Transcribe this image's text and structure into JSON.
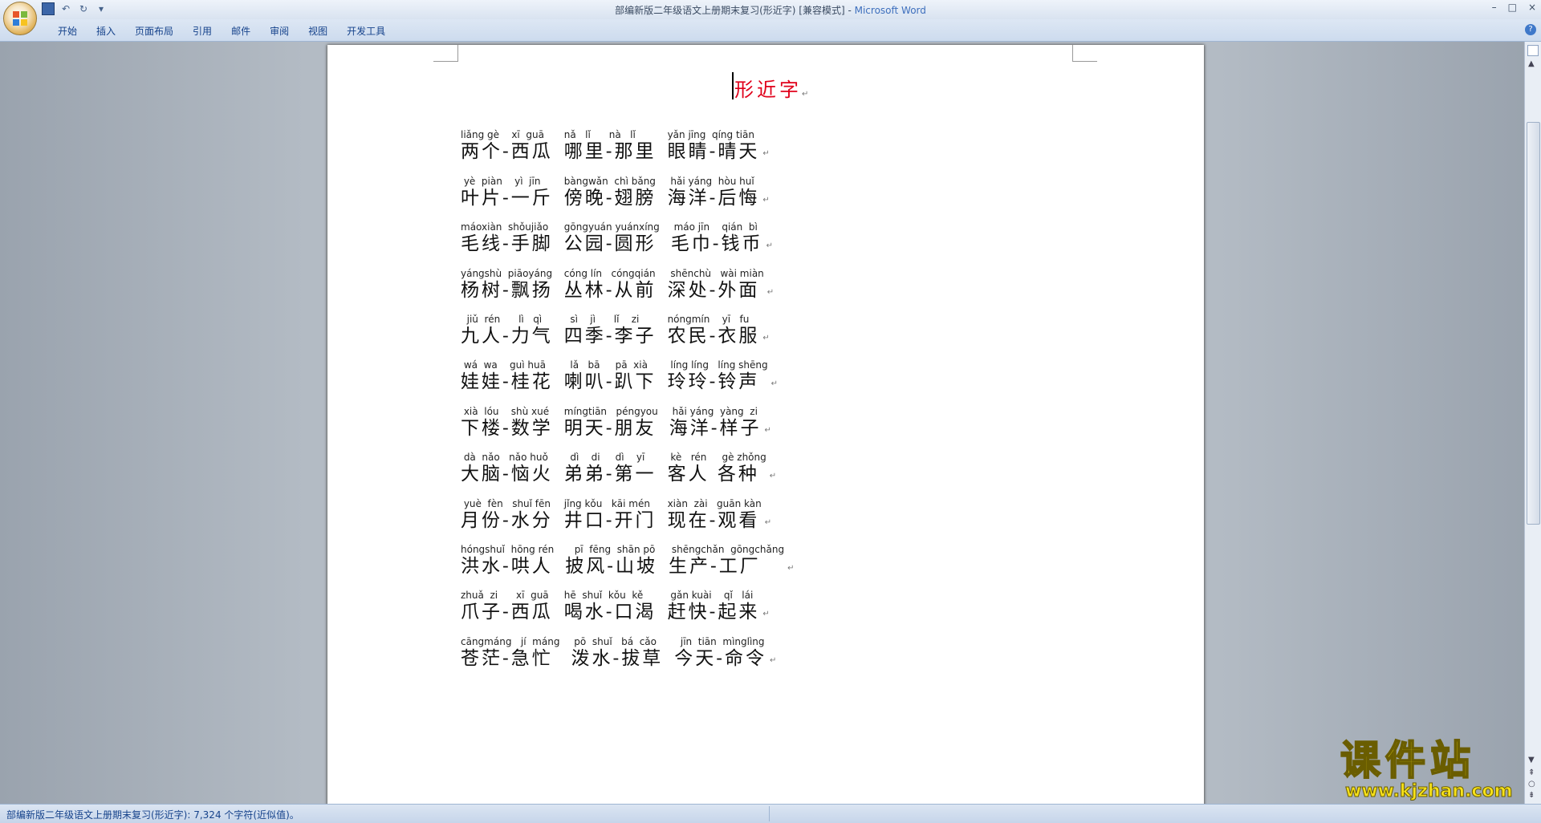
{
  "window": {
    "title": "部编新版二年级语文上册期末复习(形近字) [兼容模式] - ",
    "app_name": "Microsoft Word",
    "controls": [
      "–",
      "□",
      "×"
    ]
  },
  "qat": {
    "undo": "↶",
    "redo": "↻",
    "customize": "▾"
  },
  "ribbon": {
    "tabs": [
      "开始",
      "插入",
      "页面布局",
      "引用",
      "邮件",
      "审阅",
      "视图",
      "开发工具"
    ],
    "help": "?"
  },
  "document": {
    "title": "形近字",
    "para_mark": "↵",
    "rows": [
      {
        "groups": [
          {
            "py": "liǎng gè    xī  guā",
            "hz": "两个-西瓜"
          },
          {
            "py": "nǎ   lǐ      nà   lǐ",
            "hz": "哪里-那里"
          },
          {
            "py": "yǎn jīng  qíng tiān",
            "hz": "眼睛-晴天"
          }
        ]
      },
      {
        "groups": [
          {
            "py": " yè  piàn    yì  jīn",
            "hz": "叶片-一斤"
          },
          {
            "py": "bàngwǎn  chì bǎng",
            "hz": "傍晚-翅膀"
          },
          {
            "py": " hǎi yáng  hòu huǐ",
            "hz": "海洋-后悔"
          }
        ]
      },
      {
        "groups": [
          {
            "py": "máoxiàn  shǒujiǎo",
            "hz": "毛线-手脚"
          },
          {
            "py": "gōngyuán yuánxíng",
            "hz": "公园-圆形"
          },
          {
            "py": " máo jīn    qián  bì",
            "hz": "毛巾-钱币"
          }
        ]
      },
      {
        "groups": [
          {
            "py": "yángshù  piāoyáng",
            "hz": "杨树-飘扬"
          },
          {
            "py": "cóng lín   cóngqián",
            "hz": "丛林-从前"
          },
          {
            "py": " shēnchù   wài miàn",
            "hz": "深处-外面"
          }
        ]
      },
      {
        "groups": [
          {
            "py": "  jiǔ  rén      lì   qì",
            "hz": "九人-力气"
          },
          {
            "py": "  sì    jì      lǐ    zi",
            "hz": "四季-李子"
          },
          {
            "py": "nóngmín    yī   fu",
            "hz": "农民-衣服"
          }
        ]
      },
      {
        "groups": [
          {
            "py": " wá  wa    guì huā",
            "hz": "娃娃-桂花"
          },
          {
            "py": "  lǎ   bā     pā  xià",
            "hz": "喇叭-趴下"
          },
          {
            "py": " líng líng   líng shēng",
            "hz": "玲玲-铃声"
          }
        ]
      },
      {
        "groups": [
          {
            "py": " xià  lóu    shù xué",
            "hz": "下楼-数学"
          },
          {
            "py": "míngtiān   péngyou",
            "hz": "明天-朋友"
          },
          {
            "py": " hǎi yáng  yàng  zi",
            "hz": "海洋-样子"
          }
        ]
      },
      {
        "groups": [
          {
            "py": " dà  nǎo   nǎo huǒ",
            "hz": "大脑-恼火"
          },
          {
            "py": "  dì    di     dì    yī",
            "hz": "弟弟-第一"
          },
          {
            "py": " kè   rén     gè zhǒng",
            "hz": "客人 各种"
          }
        ]
      },
      {
        "groups": [
          {
            "py": " yuè  fèn   shuǐ fēn",
            "hz": "月份-水分"
          },
          {
            "py": "jǐng kǒu   kāi mén",
            "hz": "井口-开门"
          },
          {
            "py": "xiàn  zài   guān kàn",
            "hz": "现在-观看"
          }
        ]
      },
      {
        "groups": [
          {
            "py": "hóngshuǐ  hōng rén",
            "hz": "洪水-哄人"
          },
          {
            "py": "   pī  fēng  shān pō",
            "hz": "披风-山坡"
          },
          {
            "py": " shēngchǎn  gōngchǎng",
            "hz": "生产-工厂"
          }
        ]
      },
      {
        "groups": [
          {
            "py": "zhuǎ  zi      xī  guā",
            "hz": "爪子-西瓜"
          },
          {
            "py": "hē  shuǐ  kǒu  kě",
            "hz": "喝水-口渴"
          },
          {
            "py": " gǎn kuài    qǐ   lái",
            "hz": "赶快-起来"
          }
        ]
      },
      {
        "groups": [
          {
            "py": "cāngmáng   jí  máng",
            "hz": "苍茫-急忙"
          },
          {
            "py": " pō  shuǐ   bá  cǎo",
            "hz": "泼水-拔草"
          },
          {
            "py": "  jīn  tiān  mìnglìng",
            "hz": "今天-命令"
          }
        ]
      }
    ]
  },
  "statusbar": {
    "text": "部编新版二年级语文上册期末复习(形近字): 7,324 个字符(近似值)。"
  },
  "watermark": {
    "brand": "课件站",
    "url": "www.kjzhan.com"
  }
}
